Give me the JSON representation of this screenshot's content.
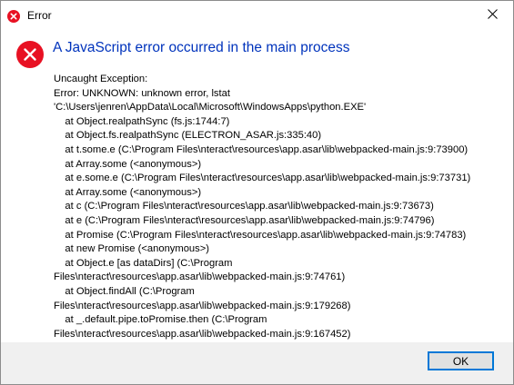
{
  "window": {
    "title": "Error",
    "close_symbol": "✕"
  },
  "dialog": {
    "heading": "A JavaScript error occurred in the main process",
    "message": "Uncaught Exception:\nError: UNKNOWN: unknown error, lstat\n'C:\\Users\\jenren\\AppData\\Local\\Microsoft\\WindowsApps\\python.EXE'\n    at Object.realpathSync (fs.js:1744:7)\n    at Object.fs.realpathSync (ELECTRON_ASAR.js:335:40)\n    at t.some.e (C:\\Program Files\\nteract\\resources\\app.asar\\lib\\webpacked-main.js:9:73900)\n    at Array.some (<anonymous>)\n    at e.some.e (C:\\Program Files\\nteract\\resources\\app.asar\\lib\\webpacked-main.js:9:73731)\n    at Array.some (<anonymous>)\n    at c (C:\\Program Files\\nteract\\resources\\app.asar\\lib\\webpacked-main.js:9:73673)\n    at e (C:\\Program Files\\nteract\\resources\\app.asar\\lib\\webpacked-main.js:9:74796)\n    at Promise (C:\\Program Files\\nteract\\resources\\app.asar\\lib\\webpacked-main.js:9:74783)\n    at new Promise (<anonymous>)\n    at Object.e [as dataDirs] (C:\\Program\nFiles\\nteract\\resources\\app.asar\\lib\\webpacked-main.js:9:74761)\n    at Object.findAll (C:\\Program\nFiles\\nteract\\resources\\app.asar\\lib\\webpacked-main.js:9:179268)\n    at _.default.pipe.toPromise.then (C:\\Program\nFiles\\nteract\\resources\\app.asar\\lib\\webpacked-main.js:9:167452)",
    "ok_label": "OK"
  },
  "icons": {
    "title_icon": "error-icon",
    "dialog_icon": "error-icon",
    "close_icon": "close-icon"
  },
  "colors": {
    "error_red": "#e81123",
    "heading_blue": "#0033bc",
    "footer_bg": "#f0f0f0",
    "button_border": "#0078d7"
  }
}
